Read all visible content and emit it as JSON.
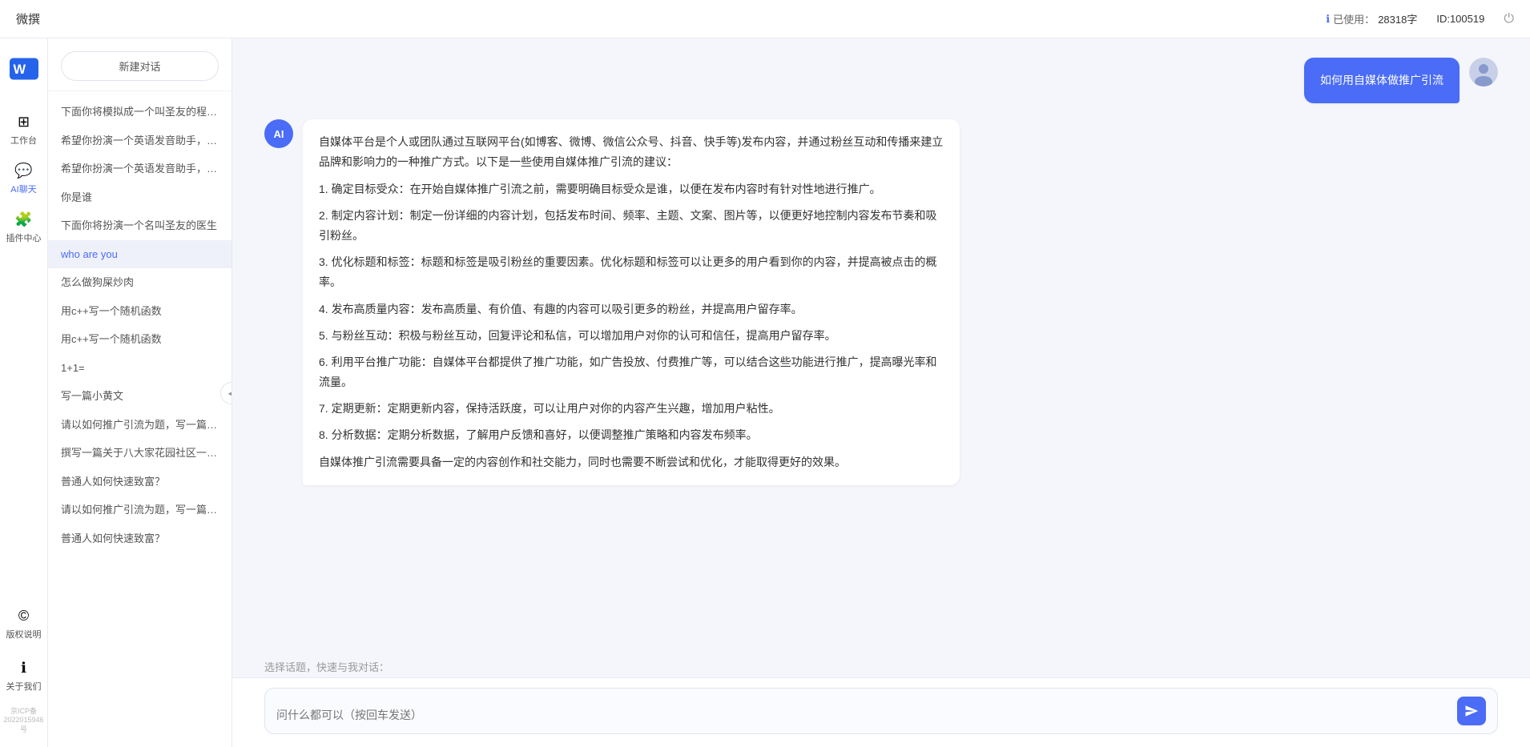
{
  "topbar": {
    "title": "微撰",
    "usage_label": "已使用：",
    "usage_value": "28318字",
    "id_label": "ID:100519",
    "logout_icon": "⏻"
  },
  "logo": {
    "text": "W 微撰"
  },
  "nav": {
    "items": [
      {
        "id": "workbench",
        "icon": "⊞",
        "label": "工作台"
      },
      {
        "id": "ai-chat",
        "icon": "💬",
        "label": "AI聊天",
        "active": true
      },
      {
        "id": "plugin",
        "icon": "🧩",
        "label": "插件中心"
      }
    ],
    "bottom_items": [
      {
        "id": "copyright",
        "icon": "©",
        "label": "版权说明"
      },
      {
        "id": "about",
        "icon": "ℹ",
        "label": "关于我们"
      }
    ],
    "icp": "京ICP备2022015946号"
  },
  "history": {
    "new_chat_label": "新建对话",
    "items": [
      {
        "id": 1,
        "text": "下面你将模拟成一个叫圣友的程序员，我说..."
      },
      {
        "id": 2,
        "text": "希望你扮演一个英语发音助手，我提供给你..."
      },
      {
        "id": 3,
        "text": "希望你扮演一个英语发音助手，我提供给你..."
      },
      {
        "id": 4,
        "text": "你是谁"
      },
      {
        "id": 5,
        "text": "下面你将扮演一个名叫圣友的医生"
      },
      {
        "id": 6,
        "text": "who are you",
        "active": true
      },
      {
        "id": 7,
        "text": "怎么做狗屎炒肉"
      },
      {
        "id": 8,
        "text": "用c++写一个随机函数"
      },
      {
        "id": 9,
        "text": "用c++写一个随机函数"
      },
      {
        "id": 10,
        "text": "1+1="
      },
      {
        "id": 11,
        "text": "写一篇小黄文"
      },
      {
        "id": 12,
        "text": "请以如何推广引流为题，写一篇大纲"
      },
      {
        "id": 13,
        "text": "撰写一篇关于八大家花园社区一刻钟便民生..."
      },
      {
        "id": 14,
        "text": "普通人如何快速致富？"
      },
      {
        "id": 15,
        "text": "请以如何推广引流为题，写一篇大纲"
      },
      {
        "id": 16,
        "text": "普通人如何快速致富？"
      }
    ]
  },
  "chat": {
    "user_message": "如何用自媒体做推广引流",
    "ai_response": {
      "paragraphs": [
        "自媒体平台是个人或团队通过互联网平台(如博客、微博、微信公众号、抖音、快手等)发布内容，并通过粉丝互动和传播来建立品牌和影响力的一种推广方式。以下是一些使用自媒体推广引流的建议：",
        "1. 确定目标受众：在开始自媒体推广引流之前，需要明确目标受众是谁，以便在发布内容时有针对性地进行推广。",
        "2. 制定内容计划：制定一份详细的内容计划，包括发布时间、频率、主题、文案、图片等，以便更好地控制内容发布节奏和吸引粉丝。",
        "3. 优化标题和标签：标题和标签是吸引粉丝的重要因素。优化标题和标签可以让更多的用户看到你的内容，并提高被点击的概率。",
        "4. 发布高质量内容：发布高质量、有价值、有趣的内容可以吸引更多的粉丝，并提高用户留存率。",
        "5. 与粉丝互动：积极与粉丝互动，回复评论和私信，可以增加用户对你的认可和信任，提高用户留存率。",
        "6. 利用平台推广功能：自媒体平台都提供了推广功能，如广告投放、付费推广等，可以结合这些功能进行推广，提高曝光率和流量。",
        "7. 定期更新：定期更新内容，保持活跃度，可以让用户对你的内容产生兴趣，增加用户粘性。",
        "8. 分析数据：定期分析数据，了解用户反馈和喜好，以便调整推广策略和内容发布频率。",
        "自媒体推广引流需要具备一定的内容创作和社交能力，同时也需要不断尝试和优化，才能取得更好的效果。"
      ]
    },
    "quick_topics_label": "选择话题，快速与我对话：",
    "input_placeholder": "问什么都可以（按回车发送）"
  }
}
